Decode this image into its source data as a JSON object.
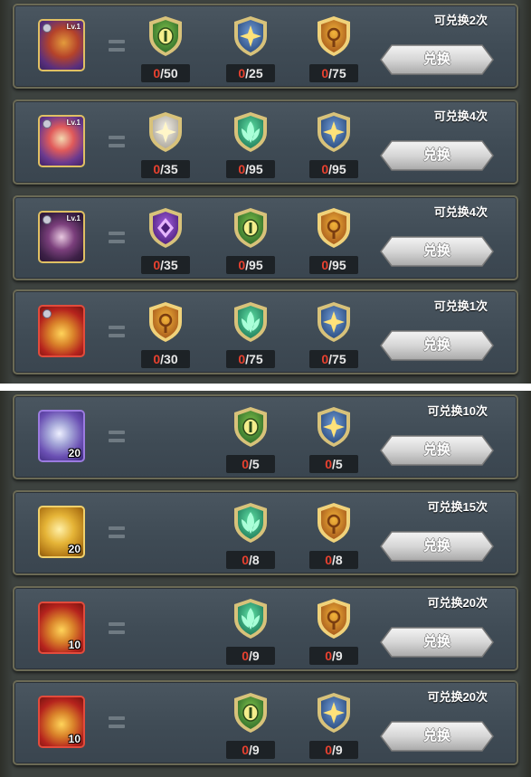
{
  "exchange_button_label": "兑换",
  "colors": {
    "count_have": "#e8412f",
    "count_need": "#e8e8e8",
    "panel": "#3d423f",
    "row": "#44505a",
    "button": "#d8d8d8"
  },
  "badge_styles": {
    "green": {
      "base": "#2e6b2a",
      "light": "#7fc24a",
      "rim": "#d8c27a",
      "center": "#f4ee8c"
    },
    "blue": {
      "base": "#2a4b7d",
      "light": "#6f9ad6",
      "rim": "#d8c27a",
      "center": "#ffe27a"
    },
    "gold": {
      "base": "#a4561a",
      "light": "#f2b43a",
      "rim": "#f0d27a",
      "center": "#7a3d10"
    },
    "silver": {
      "base": "#a9a49a",
      "light": "#f4f1e8",
      "rim": "#d8c27a",
      "center": "#fff6c8"
    },
    "emerald": {
      "base": "#1f7a5a",
      "light": "#5ee0a4",
      "rim": "#d8c27a",
      "center": "#a9ffd8"
    },
    "purple": {
      "base": "#4b1f7a",
      "light": "#a35ee0",
      "rim": "#d8c27a",
      "center": "#e6b5ff"
    }
  },
  "rows": [
    {
      "source": {
        "icon": "hero-portrait-icon",
        "style": "hero-a",
        "level": "Lv.1",
        "qty": ""
      },
      "limit": "可兑换2次",
      "requirements": [
        {
          "badge": "green",
          "have": "0",
          "need": "/50"
        },
        {
          "badge": "blue",
          "have": "0",
          "need": "/25"
        },
        {
          "badge": "gold",
          "have": "0",
          "need": "/75"
        }
      ]
    },
    {
      "source": {
        "icon": "hero-portrait-icon",
        "style": "hero-b",
        "level": "Lv.1",
        "qty": ""
      },
      "limit": "可兑换4次",
      "requirements": [
        {
          "badge": "silver",
          "have": "0",
          "need": "/35"
        },
        {
          "badge": "emerald",
          "have": "0",
          "need": "/95"
        },
        {
          "badge": "blue",
          "have": "0",
          "need": "/95"
        }
      ]
    },
    {
      "source": {
        "icon": "hero-portrait-icon",
        "style": "hero-c",
        "level": "Lv.1",
        "qty": ""
      },
      "limit": "可兑换4次",
      "requirements": [
        {
          "badge": "purple",
          "have": "0",
          "need": "/35"
        },
        {
          "badge": "green",
          "have": "0",
          "need": "/95"
        },
        {
          "badge": "gold",
          "have": "0",
          "need": "/95"
        }
      ]
    },
    {
      "source": {
        "icon": "treasure-chest-icon",
        "style": "chest-red",
        "level": "",
        "qty": ""
      },
      "limit": "可兑换1次",
      "requirements": [
        {
          "badge": "gold",
          "have": "0",
          "need": "/30"
        },
        {
          "badge": "emerald",
          "have": "0",
          "need": "/75"
        },
        {
          "badge": "blue",
          "have": "0",
          "need": "/75"
        }
      ]
    },
    {
      "source": {
        "icon": "stone-icon",
        "style": "stone-purple",
        "level": "",
        "qty": "20"
      },
      "limit": "可兑换10次",
      "requirements": [
        {
          "badge": "green",
          "have": "0",
          "need": "/5"
        },
        {
          "badge": "blue",
          "have": "0",
          "need": "/5"
        }
      ]
    },
    {
      "source": {
        "icon": "gold-coin-icon",
        "style": "coin-gold",
        "level": "",
        "qty": "20"
      },
      "limit": "可兑换15次",
      "requirements": [
        {
          "badge": "emerald",
          "have": "0",
          "need": "/8"
        },
        {
          "badge": "gold",
          "have": "0",
          "need": "/8"
        }
      ]
    },
    {
      "source": {
        "icon": "treasure-chest-icon",
        "style": "chest-red",
        "level": "",
        "qty": "10"
      },
      "limit": "可兑换20次",
      "requirements": [
        {
          "badge": "emerald",
          "have": "0",
          "need": "/9"
        },
        {
          "badge": "gold",
          "have": "0",
          "need": "/9"
        }
      ]
    },
    {
      "source": {
        "icon": "treasure-chest-icon",
        "style": "chest-red",
        "level": "",
        "qty": "10"
      },
      "limit": "可兑换20次",
      "requirements": [
        {
          "badge": "green",
          "have": "0",
          "need": "/9"
        },
        {
          "badge": "blue",
          "have": "0",
          "need": "/9"
        }
      ]
    }
  ]
}
